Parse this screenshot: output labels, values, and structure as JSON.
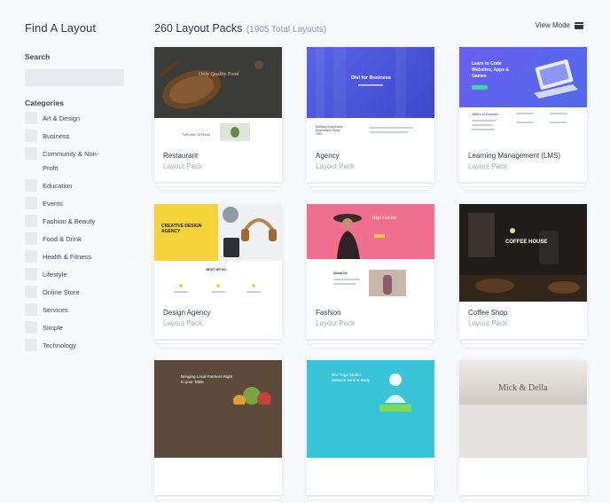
{
  "sidebar": {
    "title": "Find A Layout",
    "search_label": "Search",
    "search_placeholder": "",
    "categories_label": "Categories",
    "categories": [
      "Art & Design",
      "Business",
      "Community & Non-Profit",
      "Education",
      "Events",
      "Fashion & Beauty",
      "Food & Drink",
      "Health & Fitness",
      "Lifestyle",
      "Online Store",
      "Services",
      "Simple",
      "Technology"
    ]
  },
  "header": {
    "count": "260 Layout Packs",
    "total": "(1905 Total Layouts)",
    "view_mode": "View Mode"
  },
  "packs": [
    {
      "name": "Restaurant",
      "type": "Layout Pack",
      "thumb_text": "Only Quality Food",
      "sub_text": "Welcome To Bread"
    },
    {
      "name": "Agency",
      "type": "Layout Pack",
      "thumb_text": "Divi for Business",
      "sub_text": "Building Successful Businesses Since 1991"
    },
    {
      "name": "Learning Management (LMS)",
      "type": "Layout Pack",
      "thumb_text": "Learn to Code Websites, Apps & Games",
      "sub_text": "1000's of Courses"
    },
    {
      "name": "Design Agency",
      "type": "Layout Pack",
      "thumb_text": "CREATIVE DESIGN AGENCY",
      "sub_text": "WHAT WE DO"
    },
    {
      "name": "Fashion",
      "type": "Layout Pack",
      "thumb_text": "High Fashion",
      "sub_text": "About Us"
    },
    {
      "name": "Coffee Shop",
      "type": "Layout Pack",
      "thumb_text": "COFFEE HOUSE",
      "sub_text": ""
    },
    {
      "name": "",
      "type": "",
      "thumb_text": "Bringing Local Farmers Right to your Table",
      "sub_text": ""
    },
    {
      "name": "",
      "type": "",
      "thumb_text": "Divi Yoga Studio: Balance Mind & Body",
      "sub_text": ""
    },
    {
      "name": "",
      "type": "",
      "thumb_text": "Mick & Della",
      "sub_text": ""
    }
  ],
  "colors": {
    "accent_blue": "#4f5de8",
    "yellow": "#f5d33a",
    "pink": "#f06f8e",
    "teal": "#38c3d6"
  }
}
